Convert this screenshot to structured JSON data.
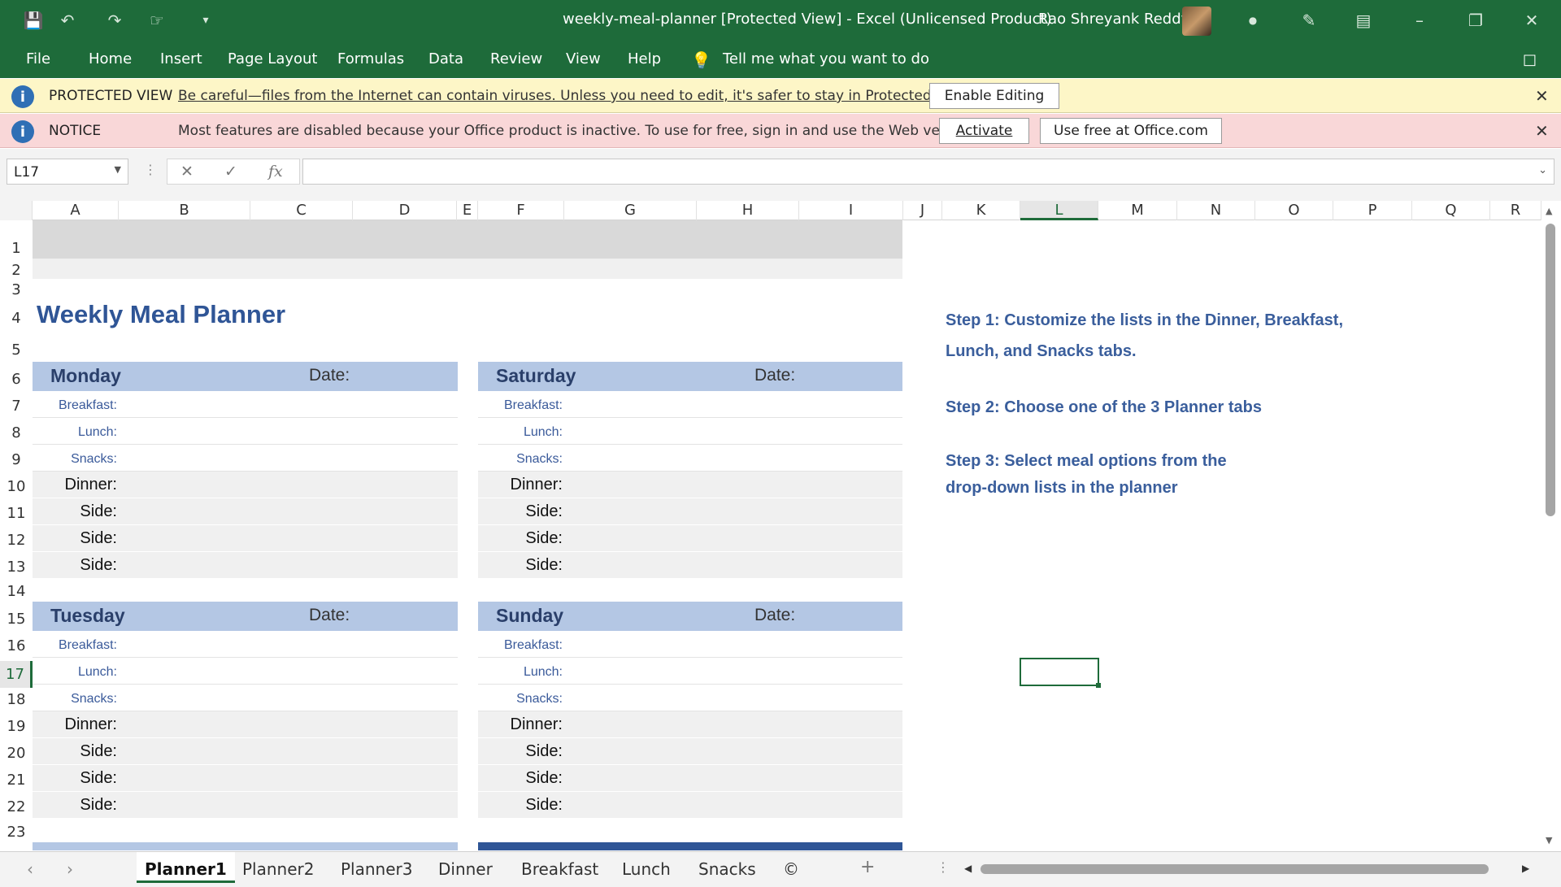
{
  "window": {
    "title": "weekly-meal-planner  [Protected View]  -  Excel (Unlicensed Product)",
    "user": "Rao Shreyank Reddy"
  },
  "menu": [
    "File",
    "Home",
    "Insert",
    "Page Layout",
    "Formulas",
    "Data",
    "Review",
    "View",
    "Help"
  ],
  "tell_me": "Tell me what you want to do",
  "protected_view": {
    "heading": "PROTECTED VIEW",
    "message": "Be careful—files from the Internet can contain viruses. Unless you need to edit, it's safer to stay in Protected View.",
    "button": "Enable Editing"
  },
  "notice": {
    "heading": "NOTICE",
    "message": "Most features are disabled because your Office product is inactive. To use for free, sign in and use the Web version.",
    "activate": "Activate",
    "web": "Use free at Office.com"
  },
  "name_box": "L17",
  "fx_label": "fx",
  "columns": [
    "A",
    "B",
    "C",
    "D",
    "E",
    "F",
    "G",
    "H",
    "I",
    "J",
    "K",
    "L",
    "M",
    "N",
    "O",
    "P",
    "Q",
    "R"
  ],
  "rows": [
    "1",
    "2",
    "3",
    "4",
    "5",
    "6",
    "7",
    "8",
    "9",
    "10",
    "11",
    "12",
    "13",
    "14",
    "15",
    "16",
    "17",
    "18",
    "19",
    "20",
    "21",
    "22",
    "23"
  ],
  "sheet": {
    "title": "Weekly Meal Planner",
    "date_label": "Date:",
    "days": {
      "mon": "Monday",
      "sat": "Saturday",
      "tue": "Tuesday",
      "sun": "Sunday"
    },
    "labels": {
      "breakfast": "Breakfast:",
      "lunch": "Lunch:",
      "snacks": "Snacks:",
      "dinner": "Dinner:",
      "side": "Side:"
    },
    "steps": {
      "s1a": "Step 1: Customize the lists in the Dinner, Breakfast,",
      "s1b": "Lunch, and Snacks tabs.",
      "s2": "Step 2: Choose one of the 3 Planner tabs",
      "s3a": "Step 3: Select meal options from the",
      "s3b": "drop-down lists in the planner"
    }
  },
  "tabs": [
    "Planner1",
    "Planner2",
    "Planner3",
    "Dinner",
    "Breakfast",
    "Lunch",
    "Snacks",
    "©"
  ],
  "colors": {
    "excel_green": "#1e6b3a",
    "header_blue": "#b4c7e4",
    "title_blue": "#2f5596"
  }
}
